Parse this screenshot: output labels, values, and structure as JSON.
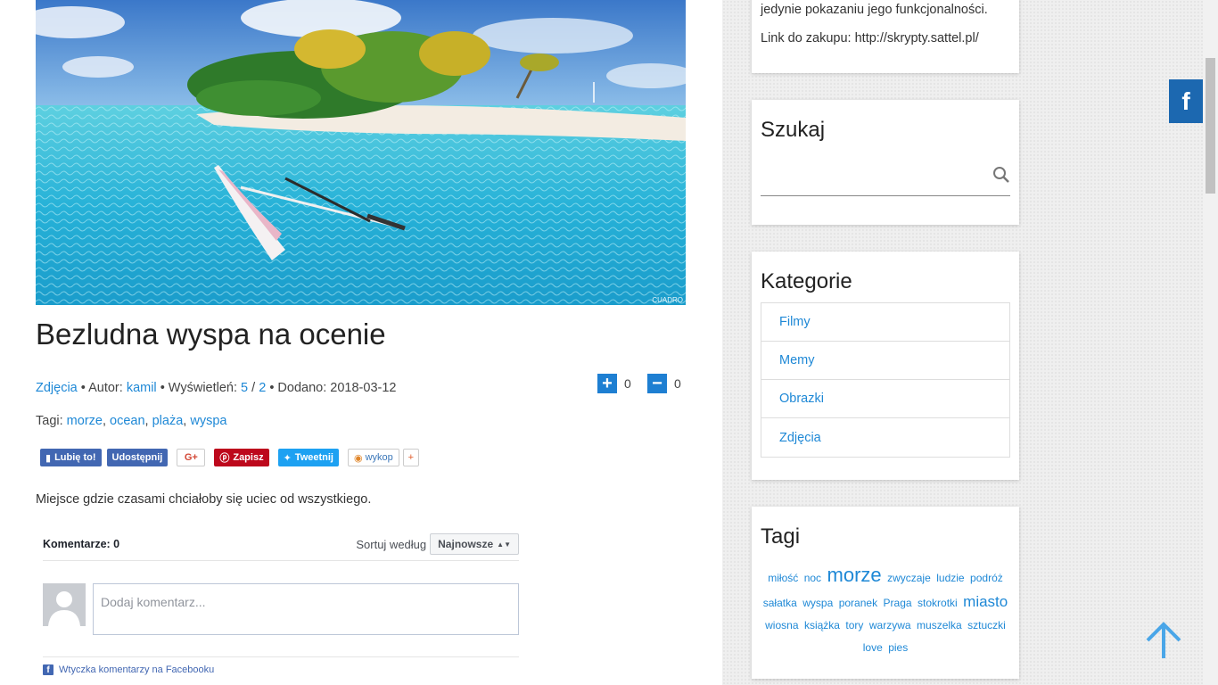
{
  "post": {
    "image_credit": "CUADRO",
    "title": "Bezludna wyspa na ocenie",
    "category": "Zdjęcia",
    "author_prefix": "• Autor:",
    "author": "kamil",
    "views_prefix": "• Wyświetleń:",
    "views_a": "5",
    "views_sep": "/",
    "views_b": "2",
    "date_prefix": "• Dodano:",
    "date": "2018-03-12",
    "vote_up_count": "0",
    "vote_down_count": "0",
    "tags_label": "Tagi:",
    "tags": [
      "morze",
      "ocean",
      "plaża",
      "wyspa"
    ],
    "description": "Miejsce gdzie czasami chciałoby się uciec od wszystkiego."
  },
  "share": {
    "like": "Lubię to!",
    "share": "Udostępnij",
    "gplus": "G+",
    "pin": "Zapisz",
    "tweet": "Tweetnij",
    "wykop": "wykop",
    "plus": "+"
  },
  "comments": {
    "count_label": "Komentarze: 0",
    "sort_label": "Sortuj według",
    "sort_value": "Najnowsze",
    "placeholder": "Dodaj komentarz...",
    "plugin_label": "Wtyczka komentarzy na Facebooku"
  },
  "sidebar": {
    "text_line1": "jedynie pokazaniu jego funkcjonalności.",
    "text_line2": "Link do zakupu: http://skrypty.sattel.pl/",
    "search_title": "Szukaj",
    "categories_title": "Kategorie",
    "categories": [
      "Filmy",
      "Memy",
      "Obrazki",
      "Zdjęcia"
    ],
    "tags_title": "Tagi",
    "tag_cloud": [
      {
        "label": "miłość",
        "size": "s"
      },
      {
        "label": "noc",
        "size": "s"
      },
      {
        "label": "morze",
        "size": "xl"
      },
      {
        "label": "zwyczaje",
        "size": "s"
      },
      {
        "label": "ludzie",
        "size": "s"
      },
      {
        "label": "podróż",
        "size": "s"
      },
      {
        "label": "sałatka",
        "size": "s"
      },
      {
        "label": "wyspa",
        "size": "s"
      },
      {
        "label": "poranek",
        "size": "s"
      },
      {
        "label": "Praga",
        "size": "s"
      },
      {
        "label": "stokrotki",
        "size": "s"
      },
      {
        "label": "miasto",
        "size": "l"
      },
      {
        "label": "wiosna",
        "size": "s"
      },
      {
        "label": "książka",
        "size": "s"
      },
      {
        "label": "tory",
        "size": "s"
      },
      {
        "label": "warzywa",
        "size": "s"
      },
      {
        "label": "muszelka",
        "size": "s"
      },
      {
        "label": "sztuczki",
        "size": "s"
      },
      {
        "label": "love",
        "size": "s"
      },
      {
        "label": "pies",
        "size": "s"
      }
    ]
  },
  "floating": {
    "fb_letter": "f"
  },
  "colors": {
    "link": "#1e88d6",
    "vote": "#1e7fd2",
    "fb_side": "#1c68b0"
  }
}
